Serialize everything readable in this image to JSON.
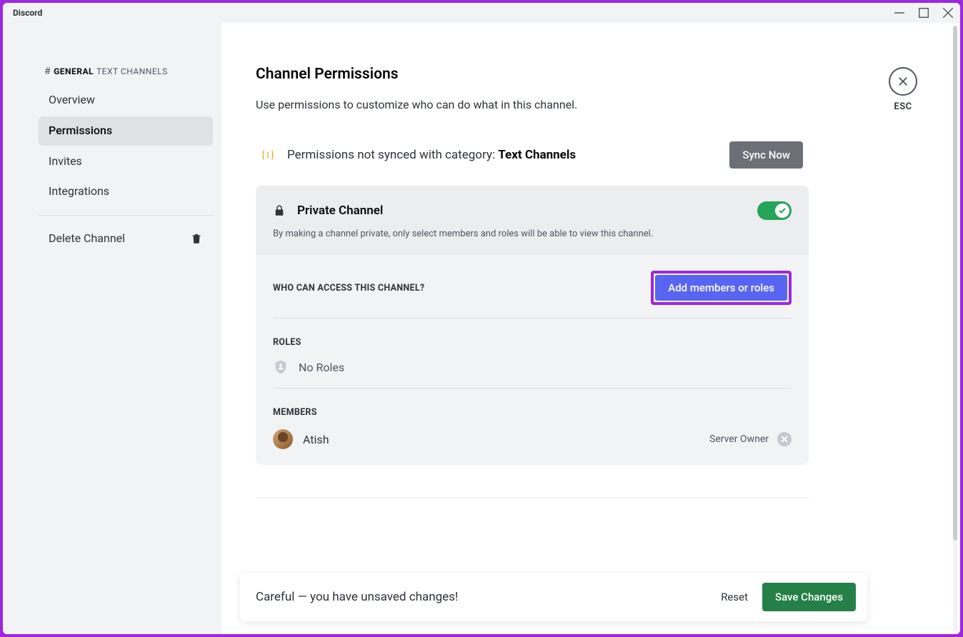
{
  "titlebar": {
    "title": "Discord"
  },
  "sidebar": {
    "hash": "#",
    "channel_name": "GENERAL",
    "category": "TEXT CHANNELS",
    "items": [
      {
        "label": "Overview"
      },
      {
        "label": "Permissions"
      },
      {
        "label": "Invites"
      },
      {
        "label": "Integrations"
      }
    ],
    "delete_label": "Delete Channel"
  },
  "page": {
    "title": "Channel Permissions",
    "subtitle": "Use permissions to customize who can do what in this channel."
  },
  "close": {
    "label": "ESC"
  },
  "sync": {
    "prefix": "Permissions not synced with category: ",
    "category": "Text Channels",
    "button": "Sync Now"
  },
  "private": {
    "title": "Private Channel",
    "description": "By making a channel private, only select members and roles will be able to view this channel.",
    "enabled": true
  },
  "access": {
    "heading": "WHO CAN ACCESS THIS CHANNEL?",
    "add_button": "Add members or roles"
  },
  "roles": {
    "heading": "ROLES",
    "empty": "No Roles"
  },
  "members": {
    "heading": "MEMBERS",
    "list": [
      {
        "name": "Atish",
        "tag": "Server Owner"
      }
    ]
  },
  "savebar": {
    "warning": "Careful — you have unsaved changes!",
    "reset": "Reset",
    "save": "Save Changes"
  }
}
